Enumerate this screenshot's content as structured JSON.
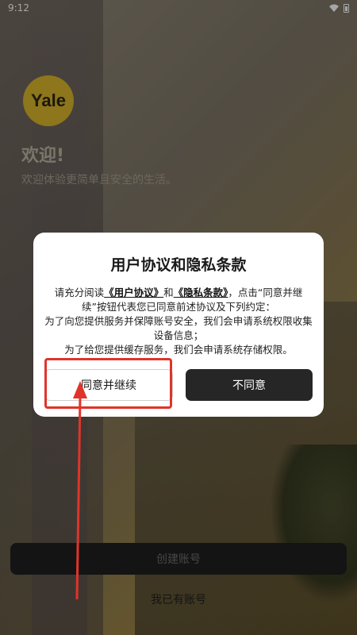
{
  "status_bar": {
    "time": "9:12"
  },
  "app": {
    "logo_text": "Yale",
    "welcome_title": "欢迎!",
    "welcome_subtitle": "欢迎体验更简单且安全的生活。",
    "create_account_label": "创建账号",
    "have_account_label": "我已有账号"
  },
  "dialog": {
    "title": "用户协议和隐私条款",
    "body_prefix": "请充分阅读",
    "link_user_agreement": "《用户协议》",
    "body_and": "和",
    "link_privacy": "《隐私条款》",
    "body_line1_rest": "，点击“同意并继续”按钮代表您已同意前述协议及下列约定：",
    "body_line2": "为了向您提供服务并保障账号安全，我们会申请系统权限收集设备信息；",
    "body_line3": "为了给您提供缓存服务，我们会申请系统存储权限。",
    "agree_label": "同意并继续",
    "disagree_label": "不同意"
  },
  "colors": {
    "accent": "#e0342b",
    "dialog_bg": "#ffffff",
    "dark_button": "#262626",
    "logo_yellow": "#d9b52a"
  }
}
